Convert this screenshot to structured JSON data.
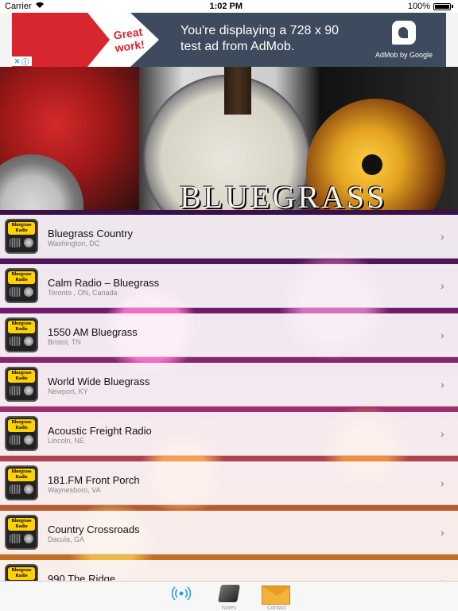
{
  "status_bar": {
    "carrier": "Carrier",
    "time": "1:02 PM",
    "battery": "100%"
  },
  "ad": {
    "badge": "Great work!",
    "message": "You're displaying a 728 x 90 test ad from AdMob.",
    "brand": "AdMob by Google"
  },
  "header": {
    "title": "BLUEGRASS"
  },
  "stations": [
    {
      "name": "Bluegrass Country",
      "location": "Washington, DC"
    },
    {
      "name": "Calm Radio – Bluegrass",
      "location": "Toronto , ON, Canada"
    },
    {
      "name": "1550 AM Bluegrass",
      "location": "Bristol, TN"
    },
    {
      "name": "World Wide Bluegrass",
      "location": "Newport, KY"
    },
    {
      "name": "Acoustic Freight Radio",
      "location": "Lincoln, NE"
    },
    {
      "name": "181.FM Front Porch",
      "location": "Waynesboro, VA"
    },
    {
      "name": "Country Crossroads",
      "location": "Dacula, GA"
    },
    {
      "name": "990 The Ridge",
      "location": ""
    }
  ],
  "station_icon_text": "Bluegrass Radio",
  "tabs": [
    {
      "label": "",
      "icon": "radio-waves-icon"
    },
    {
      "label": "Notes",
      "icon": "notes-icon"
    },
    {
      "label": "Contact",
      "icon": "envelope-icon"
    }
  ]
}
